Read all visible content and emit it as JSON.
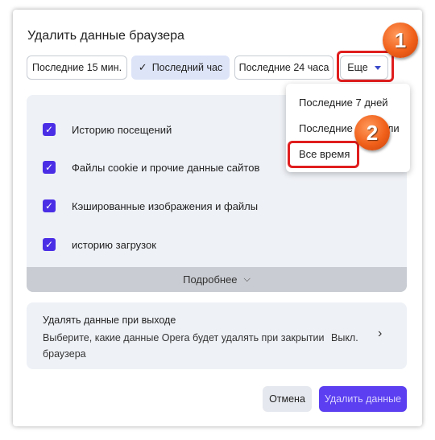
{
  "dialog": {
    "title": "Удалить данные браузера",
    "ranges": [
      {
        "label": "Последние 15 мин.",
        "selected": false
      },
      {
        "label": "Последний час",
        "selected": true
      },
      {
        "label": "Последние 24 часа",
        "selected": false
      }
    ],
    "more_label": "Еще",
    "items": [
      {
        "label": "Историю посещений",
        "checked": true
      },
      {
        "label": "Файлы cookie и прочие данные сайтов",
        "checked": true
      },
      {
        "label": "Кэшированные изображения и файлы",
        "checked": true
      },
      {
        "label": "историю загрузок",
        "checked": true
      }
    ],
    "details_label": "Подробнее",
    "on_exit": {
      "title": "Удалять данные при выходе",
      "description": "Выберите, какие данные Opera будет удалять при закрытии браузера",
      "status": "Выкл."
    },
    "cancel_label": "Отмена",
    "delete_label": "Удалить данные"
  },
  "dropdown": {
    "items": [
      "Последние 7 дней",
      "Последние 4 недели",
      "Все время"
    ]
  },
  "annotations": {
    "step1": "1",
    "step2": "2",
    "highlight_color": "#e01e1e",
    "badge_color": "#f0601a"
  },
  "colors": {
    "accent": "#5b3ff0",
    "checkbox": "#4a2ee6",
    "selected_chip": "#dde4f8"
  }
}
